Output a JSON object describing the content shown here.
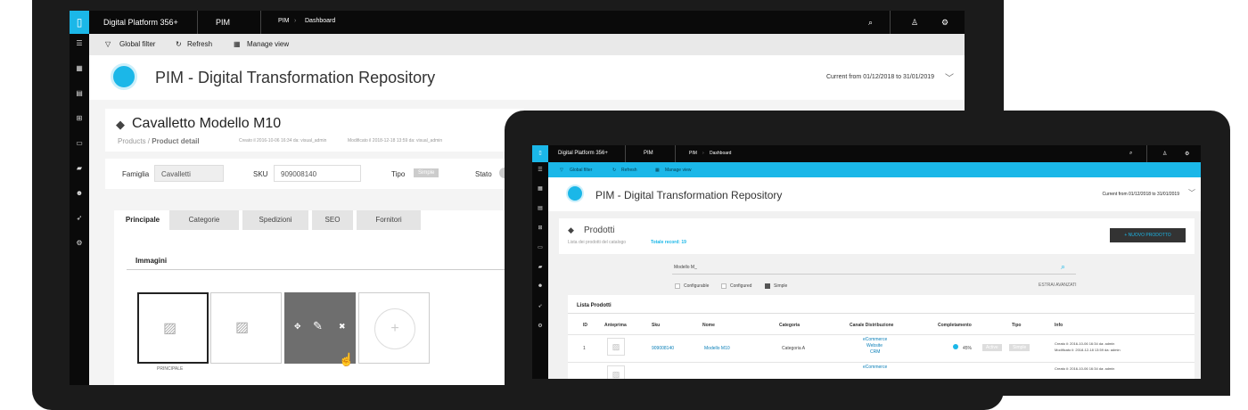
{
  "app": {
    "name": "Digital Platform 356+",
    "module": "PIM",
    "breadcrumb": [
      "PIM",
      "Dashboard"
    ]
  },
  "toolbar": {
    "global_filter": "Global filter",
    "refresh": "Refresh",
    "manage_view": "Manage view"
  },
  "header": {
    "title": "PIM -  Digital Transformation Repository",
    "current": "Current  from 01/12/2018 to 31/01/2019"
  },
  "product": {
    "title": "Cavalletto Modello M10",
    "crumbs": [
      "Products",
      "Product detail"
    ],
    "created": "Creato il 2016-10-06 16:34 da: visual_admin",
    "modified": "Modificato il 2018-12-18 13:59 da: visual_admin",
    "famiglia_label": "Famiglia",
    "famiglia_value": "Cavalletti",
    "sku_label": "SKU",
    "sku_value": "909008140",
    "tipo_label": "Tipo",
    "tipo_value": "Simple",
    "stato_label": "Stato"
  },
  "tabs": [
    "Principale",
    "Categorie",
    "Spedizioni",
    "SEO",
    "Fornitori"
  ],
  "images": {
    "section_title": "Immagini",
    "primary_caption": "PRINCIPALE"
  },
  "tablet": {
    "products_title": "Prodotti",
    "products_sub": "Lista dei prodotti del catalogo",
    "total": "Totale record: 19",
    "new_button": "+   NUOVO PRODOTTO",
    "search_value": "Modello M_",
    "filters": [
      "Configurable",
      "Configured",
      "Simple"
    ],
    "extra_filter": "ESTRAI AVANZATI",
    "list_title": "Lista Prodotti",
    "columns": [
      "ID",
      "Anteprima",
      "Sku",
      "Nome",
      "Categoria",
      "Canale Distribuzione",
      "Completamento",
      "Tipo",
      "Info"
    ],
    "rows": [
      {
        "id": "1",
        "sku": "909008140",
        "name": "Modello M10",
        "category": "Categoria A",
        "channels": [
          "eCommerce",
          "Website",
          "CRM"
        ],
        "completion": "45%",
        "tag1": "Active",
        "tag2": "Simple",
        "info1": "Creato il: 2016-10-06 16:34 da: admin",
        "info2": "Modificato il: 2018-12-18 13:59 da: admin"
      },
      {
        "id": "",
        "sku": "",
        "name": "",
        "category": "",
        "channels": [
          "eCommerce"
        ],
        "completion": "",
        "tag1": "",
        "tag2": "",
        "info1": "Creato il: 2016-10-06 16:34 da: admin",
        "info2": ""
      }
    ]
  },
  "colors": {
    "accent": "#1bb7e8",
    "dark": "#0a0a0a"
  },
  "icons": [
    "menu-icon",
    "grid-icon",
    "database-icon",
    "cart-icon",
    "monitor-icon",
    "folder-icon",
    "users-icon",
    "rocket-icon",
    "gear-icon",
    "search-icon",
    "user-icon",
    "tag-icon",
    "image-icon",
    "move-icon",
    "edit-icon",
    "trash-icon",
    "plus-icon",
    "filter-icon",
    "refresh-icon",
    "chevron-down-icon"
  ]
}
